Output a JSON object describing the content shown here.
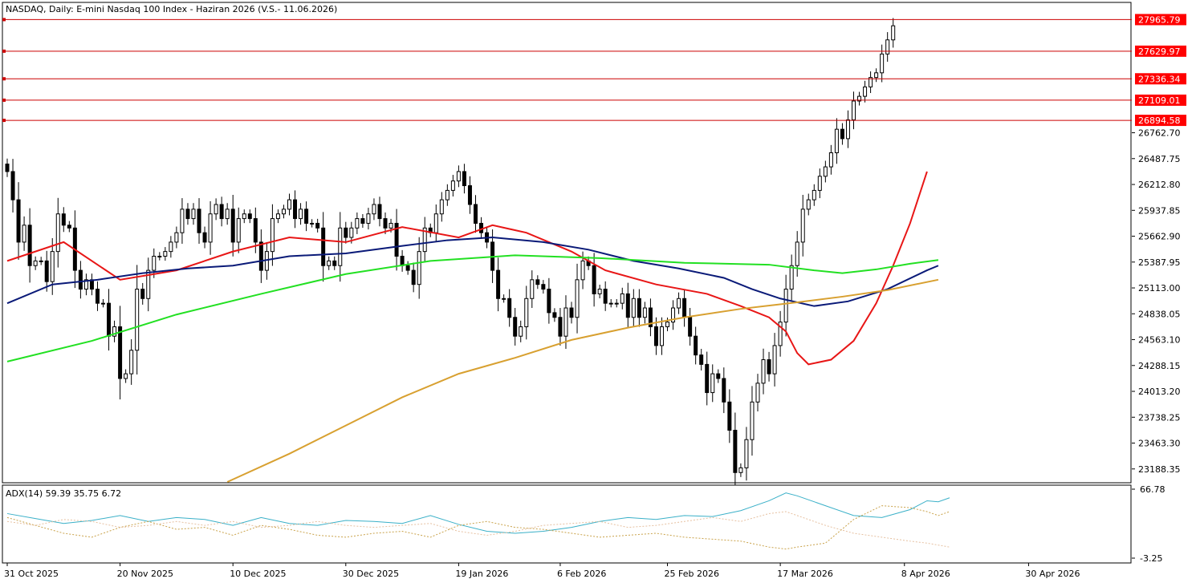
{
  "chart_data": {
    "type": "candlestick",
    "title": "NASDAQ, Daily:  E-mini Nasdaq 100 Index -  Haziran 2026 (V.S.- 11.06.2026)",
    "ylim": [
      23050,
      28140
    ],
    "price_ticks": [
      "26762.70",
      "26487.75",
      "26212.80",
      "25937.85",
      "25662.90",
      "25387.95",
      "25113.00",
      "24838.05",
      "24563.10",
      "24288.15",
      "24013.20",
      "23738.25",
      "23463.30",
      "23188.35"
    ],
    "x_labels": [
      {
        "label": "31 Oct 2025",
        "index": 0
      },
      {
        "label": "20 Nov 2025",
        "index": 20
      },
      {
        "label": "10 Dec 2025",
        "index": 40
      },
      {
        "label": "30 Dec 2025",
        "index": 60
      },
      {
        "label": "19 Jan 2026",
        "index": 80
      },
      {
        "label": "6 Feb 2026",
        "index": 98
      },
      {
        "label": "25 Feb 2026",
        "index": 117
      },
      {
        "label": "17 Mar 2026",
        "index": 137
      },
      {
        "label": "8 Apr 2026",
        "index": 159
      },
      {
        "label": "30 Apr 2026",
        "index": 181
      }
    ],
    "levels": [
      {
        "label": "27965.79",
        "value": 27965.79
      },
      {
        "label": "27629.97",
        "value": 27629.97
      },
      {
        "label": "27336.34",
        "value": 27336.34
      },
      {
        "label": "27109.01",
        "value": 27109.01
      },
      {
        "label": "26894.58",
        "value": 26894.58
      }
    ],
    "closes": [
      26350,
      26050,
      25600,
      25780,
      25350,
      25400,
      25400,
      25180,
      25500,
      25900,
      25780,
      25750,
      25300,
      25100,
      25200,
      25100,
      24950,
      24950,
      24600,
      24700,
      24150,
      24200,
      24450,
      25100,
      25000,
      25300,
      25450,
      25450,
      25500,
      25600,
      25700,
      25950,
      25850,
      25950,
      25700,
      25600,
      25900,
      26000,
      25850,
      25950,
      25600,
      25850,
      25900,
      25850,
      25600,
      25300,
      25500,
      25850,
      25900,
      25950,
      26050,
      25850,
      25950,
      25800,
      25800,
      25750,
      25350,
      25400,
      25350,
      25750,
      25650,
      25750,
      25850,
      25800,
      25900,
      26000,
      25850,
      25750,
      25800,
      25450,
      25350,
      25300,
      25150,
      25500,
      25750,
      25700,
      25900,
      26050,
      26150,
      26250,
      26350,
      26200,
      26000,
      25800,
      25700,
      25600,
      25300,
      25000,
      25000,
      24800,
      24600,
      24700,
      25000,
      25200,
      25150,
      25100,
      24850,
      24800,
      24600,
      24900,
      24800,
      25200,
      25400,
      25350,
      25050,
      25100,
      24950,
      24950,
      24950,
      25050,
      24800,
      25000,
      24800,
      24900,
      24700,
      24500,
      24700,
      24750,
      24900,
      25000,
      24800,
      24600,
      24400,
      24300,
      24000,
      24200,
      24150,
      23900,
      23600,
      23150,
      23200,
      23500,
      23900,
      24100,
      24350,
      24200,
      24500,
      24750,
      25100,
      25350,
      25600,
      25950,
      26050,
      26150,
      26300,
      26400,
      26550,
      26800,
      26700,
      26900,
      27100,
      27150,
      27250,
      27350,
      27400,
      27600,
      27750,
      27900
    ],
    "series": [
      {
        "name": "",
        "color": "#e81616",
        "points": [
          [
            0,
            25400
          ],
          [
            10,
            25600
          ],
          [
            20,
            25200
          ],
          [
            30,
            25300
          ],
          [
            40,
            25500
          ],
          [
            50,
            25650
          ],
          [
            60,
            25600
          ],
          [
            70,
            25760
          ],
          [
            80,
            25650
          ],
          [
            86,
            25780
          ],
          [
            92,
            25700
          ],
          [
            100,
            25500
          ],
          [
            106,
            25300
          ],
          [
            115,
            25150
          ],
          [
            124,
            25050
          ],
          [
            130,
            24920
          ],
          [
            135,
            24800
          ],
          [
            138,
            24650
          ],
          [
            140,
            24420
          ],
          [
            142,
            24300
          ],
          [
            146,
            24350
          ],
          [
            150,
            24550
          ],
          [
            154,
            24950
          ],
          [
            157,
            25350
          ],
          [
            160,
            25800
          ],
          [
            163,
            26350
          ]
        ]
      },
      {
        "name": "",
        "color": "#0a1a78",
        "points": [
          [
            0,
            24950
          ],
          [
            8,
            25150
          ],
          [
            16,
            25200
          ],
          [
            24,
            25270
          ],
          [
            32,
            25320
          ],
          [
            40,
            25350
          ],
          [
            50,
            25450
          ],
          [
            60,
            25480
          ],
          [
            70,
            25560
          ],
          [
            78,
            25620
          ],
          [
            86,
            25650
          ],
          [
            95,
            25600
          ],
          [
            103,
            25520
          ],
          [
            111,
            25400
          ],
          [
            119,
            25320
          ],
          [
            127,
            25220
          ],
          [
            132,
            25100
          ],
          [
            137,
            25000
          ],
          [
            143,
            24920
          ],
          [
            149,
            24970
          ],
          [
            156,
            25100
          ],
          [
            163,
            25300
          ],
          [
            165,
            25350
          ]
        ]
      },
      {
        "name": "",
        "color": "#22e022",
        "points": [
          [
            0,
            24330
          ],
          [
            15,
            24550
          ],
          [
            30,
            24830
          ],
          [
            45,
            25050
          ],
          [
            60,
            25260
          ],
          [
            75,
            25400
          ],
          [
            90,
            25460
          ],
          [
            105,
            25430
          ],
          [
            120,
            25380
          ],
          [
            135,
            25360
          ],
          [
            143,
            25300
          ],
          [
            148,
            25270
          ],
          [
            154,
            25310
          ],
          [
            160,
            25370
          ],
          [
            165,
            25410
          ]
        ]
      },
      {
        "name": "",
        "color": "#d8a030",
        "points": [
          [
            39,
            23050
          ],
          [
            50,
            23350
          ],
          [
            60,
            23650
          ],
          [
            70,
            23950
          ],
          [
            80,
            24200
          ],
          [
            90,
            24370
          ],
          [
            100,
            24560
          ],
          [
            110,
            24690
          ],
          [
            120,
            24800
          ],
          [
            130,
            24890
          ],
          [
            140,
            24960
          ],
          [
            148,
            25020
          ],
          [
            156,
            25090
          ],
          [
            165,
            25200
          ]
        ]
      }
    ],
    "adx": {
      "label": "ADX(14) 59.39 35.75 6.72",
      "ylim": [
        -3.25,
        66.78
      ],
      "tick_labels": [
        "66.78",
        "-3.25"
      ],
      "series": [
        {
          "name": "",
          "color": "#3ab0c8",
          "points": [
            [
              0,
              42
            ],
            [
              5,
              37
            ],
            [
              10,
              32
            ],
            [
              15,
              35
            ],
            [
              20,
              40
            ],
            [
              25,
              34
            ],
            [
              30,
              38
            ],
            [
              35,
              36
            ],
            [
              40,
              30
            ],
            [
              45,
              38
            ],
            [
              50,
              32
            ],
            [
              55,
              30
            ],
            [
              60,
              35
            ],
            [
              65,
              34
            ],
            [
              70,
              32
            ],
            [
              75,
              40
            ],
            [
              80,
              31
            ],
            [
              85,
              24
            ],
            [
              90,
              22
            ],
            [
              95,
              24
            ],
            [
              100,
              28
            ],
            [
              105,
              34
            ],
            [
              110,
              38
            ],
            [
              115,
              36
            ],
            [
              120,
              40
            ],
            [
              125,
              39
            ],
            [
              130,
              45
            ],
            [
              135,
              55
            ],
            [
              138,
              63
            ],
            [
              140,
              60
            ],
            [
              145,
              50
            ],
            [
              150,
              40
            ],
            [
              155,
              38
            ],
            [
              160,
              46
            ],
            [
              163,
              55
            ],
            [
              165,
              54
            ],
            [
              167,
              58
            ]
          ]
        },
        {
          "name": "",
          "color": "#c9a24a",
          "points": [
            [
              0,
              38
            ],
            [
              5,
              30
            ],
            [
              10,
              22
            ],
            [
              15,
              18
            ],
            [
              20,
              28
            ],
            [
              25,
              34
            ],
            [
              30,
              26
            ],
            [
              35,
              28
            ],
            [
              40,
              20
            ],
            [
              45,
              30
            ],
            [
              50,
              26
            ],
            [
              55,
              20
            ],
            [
              60,
              18
            ],
            [
              65,
              22
            ],
            [
              70,
              24
            ],
            [
              75,
              18
            ],
            [
              80,
              30
            ],
            [
              85,
              34
            ],
            [
              90,
              28
            ],
            [
              95,
              26
            ],
            [
              100,
              22
            ],
            [
              105,
              18
            ],
            [
              110,
              20
            ],
            [
              115,
              22
            ],
            [
              120,
              18
            ],
            [
              125,
              16
            ],
            [
              130,
              14
            ],
            [
              135,
              8
            ],
            [
              138,
              6
            ],
            [
              140,
              8
            ],
            [
              145,
              12
            ],
            [
              150,
              36
            ],
            [
              155,
              50
            ],
            [
              160,
              48
            ],
            [
              163,
              44
            ],
            [
              165,
              40
            ],
            [
              167,
              44
            ]
          ]
        },
        {
          "name": "",
          "color": "#e6c0a0",
          "points": [
            [
              0,
              34
            ],
            [
              5,
              30
            ],
            [
              10,
              36
            ],
            [
              15,
              34
            ],
            [
              20,
              28
            ],
            [
              25,
              30
            ],
            [
              30,
              34
            ],
            [
              35,
              30
            ],
            [
              40,
              34
            ],
            [
              45,
              28
            ],
            [
              50,
              30
            ],
            [
              55,
              34
            ],
            [
              60,
              30
            ],
            [
              65,
              28
            ],
            [
              70,
              30
            ],
            [
              75,
              32
            ],
            [
              80,
              24
            ],
            [
              85,
              20
            ],
            [
              90,
              24
            ],
            [
              95,
              30
            ],
            [
              100,
              32
            ],
            [
              105,
              34
            ],
            [
              110,
              28
            ],
            [
              115,
              30
            ],
            [
              120,
              34
            ],
            [
              125,
              38
            ],
            [
              130,
              34
            ],
            [
              135,
              42
            ],
            [
              138,
              44
            ],
            [
              140,
              40
            ],
            [
              145,
              30
            ],
            [
              150,
              22
            ],
            [
              155,
              18
            ],
            [
              160,
              14
            ],
            [
              163,
              12
            ],
            [
              165,
              10
            ],
            [
              167,
              8
            ]
          ]
        }
      ]
    }
  }
}
